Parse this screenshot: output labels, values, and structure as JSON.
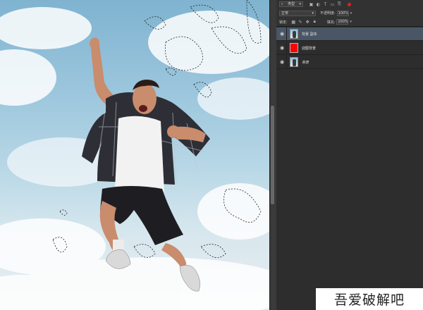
{
  "panel": {
    "filter": {
      "kind_label": "类型"
    },
    "blend": {
      "mode": "正常",
      "opacity_label": "不透明度:",
      "opacity_value": "100%"
    },
    "lock": {
      "lock_label": "锁定:",
      "fill_label": "填充:",
      "fill_value": "100%"
    },
    "layers": [
      {
        "name": "背景 副本",
        "thumb": "photo",
        "selected": true
      },
      {
        "name": "迎图背景",
        "thumb": "red",
        "selected": false
      },
      {
        "name": "背景",
        "thumb": "photo",
        "selected": false
      }
    ]
  },
  "icons": {
    "eye": "eye-icon",
    "filter": "search-icon",
    "pixel": "image-filter-icon",
    "adjust": "adjustment-filter-icon",
    "type": "text-filter-icon",
    "shape": "shape-filter-icon",
    "smart": "smart-object-filter-icon",
    "toggle": "filter-toggle-icon",
    "lock_transparent": "lock-transparent-icon",
    "lock_brush": "lock-brush-icon",
    "lock_move": "lock-move-icon",
    "lock_all": "lock-all-icon"
  },
  "colors": {
    "panel_bg": "#2d2d2d",
    "selected_row": "#4a5666",
    "red_layer": "#ff0000",
    "toggle_dot": "#d8232a"
  },
  "watermark": {
    "text": "吾爱破解吧"
  }
}
